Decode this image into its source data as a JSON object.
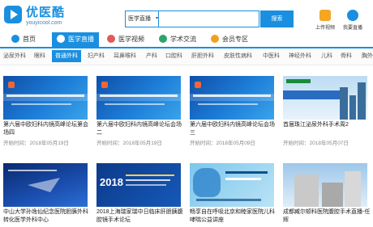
{
  "header": {
    "logo_text": "优医酷",
    "logo_sub": "youyicool.com",
    "search_category": "医学直播",
    "search_placeholder": "",
    "search_button": "搜索",
    "upload_label": "上传视频",
    "want_learn_label": "我要直播"
  },
  "nav": [
    {
      "label": "首页",
      "icon": "home-icon",
      "color": "#1a8fe0"
    },
    {
      "label": "医学直播",
      "icon": "live-icon",
      "color": "#ffffff",
      "active": true
    },
    {
      "label": "医学视频",
      "icon": "video-icon",
      "color": "#e05a5a"
    },
    {
      "label": "学术交流",
      "icon": "chat-icon",
      "color": "#2fa36b"
    },
    {
      "label": "会员专区",
      "icon": "vip-icon",
      "color": "#f0a020"
    }
  ],
  "categories": [
    "泌尿外科",
    "眼科",
    "普通外科",
    "妇产科",
    "耳鼻喉科",
    "产科",
    "口腔科",
    "肝胆外科",
    "皮肤性病科",
    "中医科",
    "神经外科",
    "儿科",
    "骨科",
    "胸外"
  ],
  "active_category": "普通外科",
  "cards": [
    {
      "title": "第六届中欧妇科内镜高峰论坛第会场四",
      "date": "开始时间：2018年05月19日",
      "thumb": "blue"
    },
    {
      "title": "第六届中欧妇科内镜高峰论坛会场二",
      "date": "开始时间：2018年05月19日",
      "thumb": "blue"
    },
    {
      "title": "第六届中欧妇科内镜高峰论坛会场三",
      "date": "开始时间：2018年05月09日",
      "thumb": "blue"
    },
    {
      "title": "首届珠江泌尿外科手术周2",
      "date": "开始时间：2018年05月07日",
      "thumb": "city"
    },
    {
      "title": "中山大学孙逸仙纪念医院胆胰外科转化医学外科中心",
      "date": "",
      "thumb": "dark"
    },
    {
      "title": "2018上海瑞家瑞中日临床肝胆胰腹腔镜手术论坛",
      "date": "",
      "thumb": "2018"
    },
    {
      "title": "畅享自在呼吸北京和睦家医院儿科哮喘公益讲座",
      "date": "",
      "thumb": "breathe"
    },
    {
      "title": "成都臧尔顿科医院腹腔手术直播-任辉",
      "date": "",
      "thumb": "hosp"
    }
  ]
}
